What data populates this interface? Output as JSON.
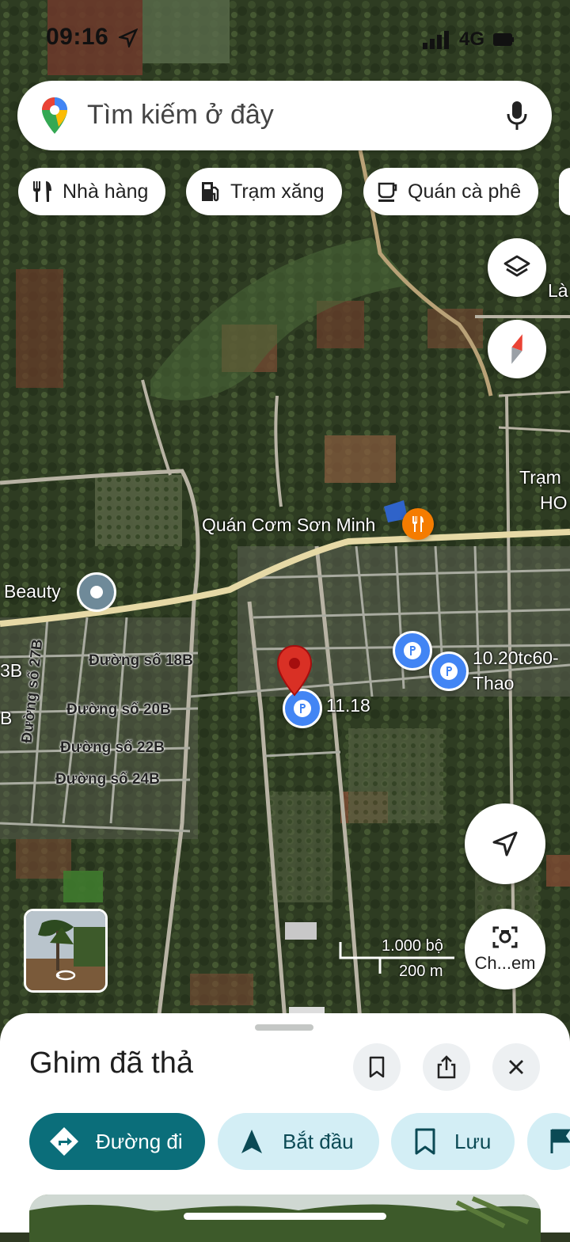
{
  "status_bar": {
    "time": "09:16",
    "network": "4G"
  },
  "search": {
    "placeholder": "Tìm kiếm ở đây"
  },
  "chips": [
    {
      "label": "Nhà hàng",
      "icon": "fork-knife-icon"
    },
    {
      "label": "Trạm xăng",
      "icon": "gas-station-icon"
    },
    {
      "label": "Quán cà phê",
      "icon": "coffee-cup-icon"
    }
  ],
  "map": {
    "place_labels": {
      "restaurant": "Quán Cơm Sơn Minh",
      "beauty": "Beauty",
      "la": "Là",
      "tram": "Trạm",
      "ho": "HO",
      "parking_1": "11.18",
      "parking_2a": "10.20tc60-",
      "parking_2b": "Thao",
      "left_3b": "3B",
      "left_b": "B"
    },
    "streets": {
      "s18b": "Đường số 18B",
      "s20b": "Đường số 20B",
      "s22b": "Đường số 22B",
      "s24b": "Đường số 24B",
      "s27b": "Đường số 27B"
    },
    "scale": {
      "imperial": "1.000 bộ",
      "metric": "200 m"
    },
    "camera_label": "Ch...em"
  },
  "sheet": {
    "title": "Ghim đã thả",
    "actions": [
      {
        "label": "Đường đi",
        "icon": "directions-icon",
        "primary": true
      },
      {
        "label": "Bắt đầu",
        "icon": "navigation-arrow-icon"
      },
      {
        "label": "Lưu",
        "icon": "bookmark-icon"
      }
    ]
  },
  "colors": {
    "primary": "#0b6e7a",
    "secondary_bg": "#d3eef5",
    "pin": "#d93025",
    "parking": "#4285f4",
    "restaurant": "#f57c00"
  }
}
